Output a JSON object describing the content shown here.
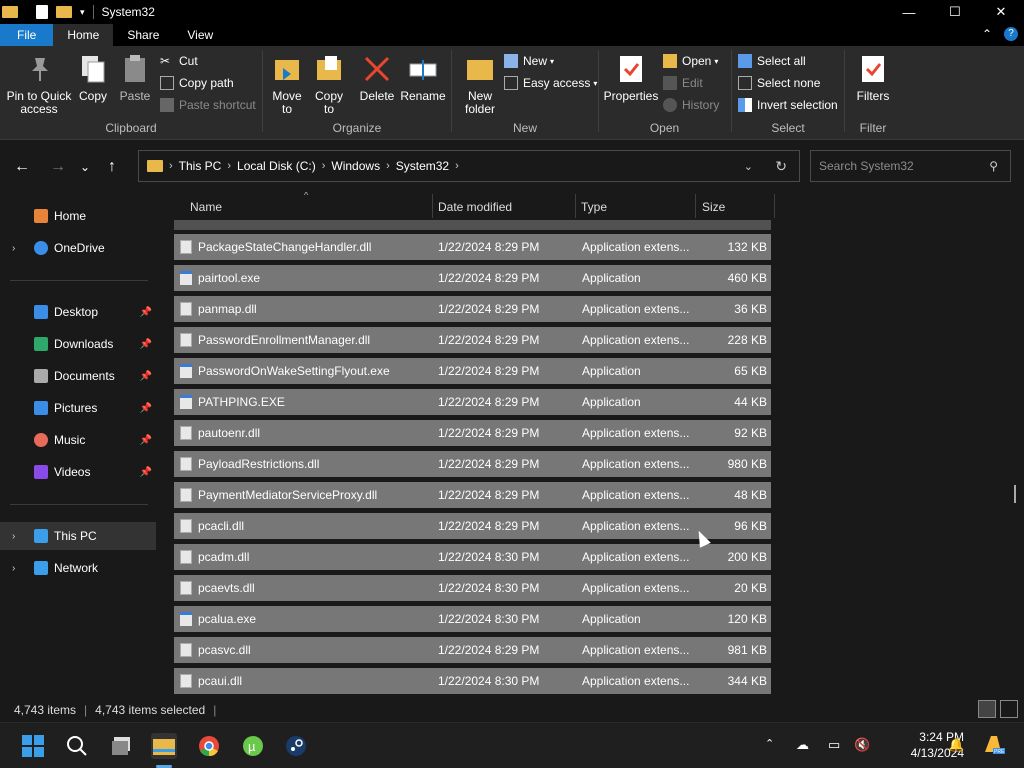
{
  "window": {
    "title": "System32",
    "controls": {
      "minimize": "—",
      "maximize": "☐",
      "close": "✕"
    }
  },
  "ribbon_tabs": {
    "file": "File",
    "home": "Home",
    "share": "Share",
    "view": "View"
  },
  "ribbon": {
    "clipboard": {
      "label": "Clipboard",
      "pin": "Pin to Quick access",
      "copy": "Copy",
      "paste": "Paste",
      "cut": "Cut",
      "copy_path": "Copy path",
      "paste_shortcut": "Paste shortcut"
    },
    "organize": {
      "label": "Organize",
      "move_to": "Move to",
      "copy_to": "Copy to",
      "delete": "Delete",
      "rename": "Rename"
    },
    "new": {
      "label": "New",
      "new_folder": "New folder",
      "new_item": "New",
      "easy_access": "Easy access"
    },
    "open": {
      "label": "Open",
      "properties": "Properties",
      "open": "Open",
      "edit": "Edit",
      "history": "History"
    },
    "select": {
      "label": "Select",
      "select_all": "Select all",
      "select_none": "Select none",
      "invert": "Invert selection"
    },
    "filter": {
      "label": "Filter",
      "filters": "Filters"
    }
  },
  "address": {
    "crumbs": [
      "This PC",
      "Local Disk (C:)",
      "Windows",
      "System32"
    ],
    "search_placeholder": "Search System32"
  },
  "nav_pane": {
    "home": "Home",
    "onedrive": "OneDrive",
    "desktop": "Desktop",
    "downloads": "Downloads",
    "documents": "Documents",
    "pictures": "Pictures",
    "music": "Music",
    "videos": "Videos",
    "this_pc": "This PC",
    "network": "Network"
  },
  "columns": {
    "name": "Name",
    "date": "Date modified",
    "type": "Type",
    "size": "Size"
  },
  "files": [
    {
      "name": "PackageStateChangeHandler.dll",
      "date": "1/22/2024 8:29 PM",
      "type": "Application extens...",
      "size": "132 KB",
      "kind": "dll"
    },
    {
      "name": "pairtool.exe",
      "date": "1/22/2024 8:29 PM",
      "type": "Application",
      "size": "460 KB",
      "kind": "exe"
    },
    {
      "name": "panmap.dll",
      "date": "1/22/2024 8:29 PM",
      "type": "Application extens...",
      "size": "36 KB",
      "kind": "dll"
    },
    {
      "name": "PasswordEnrollmentManager.dll",
      "date": "1/22/2024 8:29 PM",
      "type": "Application extens...",
      "size": "228 KB",
      "kind": "dll"
    },
    {
      "name": "PasswordOnWakeSettingFlyout.exe",
      "date": "1/22/2024 8:29 PM",
      "type": "Application",
      "size": "65 KB",
      "kind": "exe"
    },
    {
      "name": "PATHPING.EXE",
      "date": "1/22/2024 8:29 PM",
      "type": "Application",
      "size": "44 KB",
      "kind": "exe"
    },
    {
      "name": "pautoenr.dll",
      "date": "1/22/2024 8:29 PM",
      "type": "Application extens...",
      "size": "92 KB",
      "kind": "dll"
    },
    {
      "name": "PayloadRestrictions.dll",
      "date": "1/22/2024 8:29 PM",
      "type": "Application extens...",
      "size": "980 KB",
      "kind": "dll"
    },
    {
      "name": "PaymentMediatorServiceProxy.dll",
      "date": "1/22/2024 8:29 PM",
      "type": "Application extens...",
      "size": "48 KB",
      "kind": "dll"
    },
    {
      "name": "pcacli.dll",
      "date": "1/22/2024 8:29 PM",
      "type": "Application extens...",
      "size": "96 KB",
      "kind": "dll"
    },
    {
      "name": "pcadm.dll",
      "date": "1/22/2024 8:30 PM",
      "type": "Application extens...",
      "size": "200 KB",
      "kind": "dll"
    },
    {
      "name": "pcaevts.dll",
      "date": "1/22/2024 8:30 PM",
      "type": "Application extens...",
      "size": "20 KB",
      "kind": "dll"
    },
    {
      "name": "pcalua.exe",
      "date": "1/22/2024 8:30 PM",
      "type": "Application",
      "size": "120 KB",
      "kind": "exe"
    },
    {
      "name": "pcasvc.dll",
      "date": "1/22/2024 8:29 PM",
      "type": "Application extens...",
      "size": "981 KB",
      "kind": "dll"
    },
    {
      "name": "pcaui.dll",
      "date": "1/22/2024 8:30 PM",
      "type": "Application extens...",
      "size": "344 KB",
      "kind": "dll"
    }
  ],
  "status": {
    "items": "4,743 items",
    "selected": "4,743 items selected"
  },
  "clock": {
    "time": "3:24 PM",
    "date": "4/13/2024"
  },
  "colors": {
    "accent": "#1979ca",
    "selected_row": "#777777",
    "ribbon_bg": "#2b2b2b"
  }
}
